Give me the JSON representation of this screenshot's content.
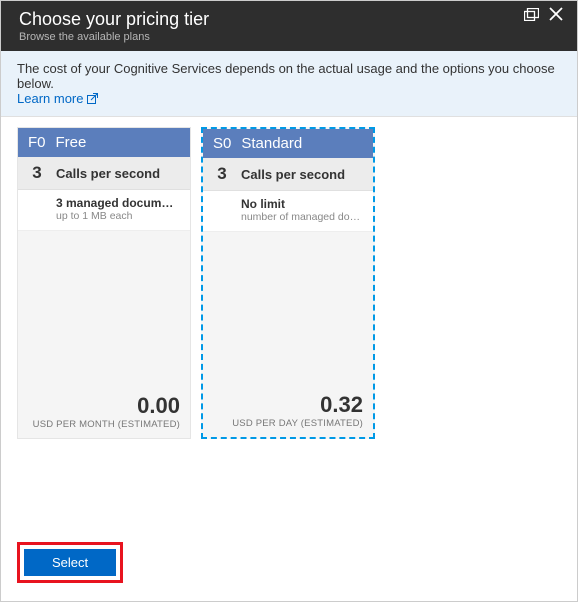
{
  "header": {
    "title": "Choose your pricing tier",
    "subtitle": "Browse the available plans"
  },
  "info_banner": {
    "text": "The cost of your Cognitive Services depends on the actual usage and the options you choose below.",
    "learn_more_label": "Learn more"
  },
  "tiers": [
    {
      "code": "F0",
      "name": "Free",
      "calls_num": "3",
      "calls_label": "Calls per second",
      "detail_primary": "3 managed documents",
      "detail_secondary": "up to 1 MB each",
      "price": "0.00",
      "price_caption": "USD PER MONTH (ESTIMATED)",
      "selected": false
    },
    {
      "code": "S0",
      "name": "Standard",
      "calls_num": "3",
      "calls_label": "Calls per second",
      "detail_primary": "No limit",
      "detail_secondary": "number of managed docu...",
      "price": "0.32",
      "price_caption": "USD PER DAY (ESTIMATED)",
      "selected": true
    }
  ],
  "footer": {
    "select_label": "Select"
  }
}
